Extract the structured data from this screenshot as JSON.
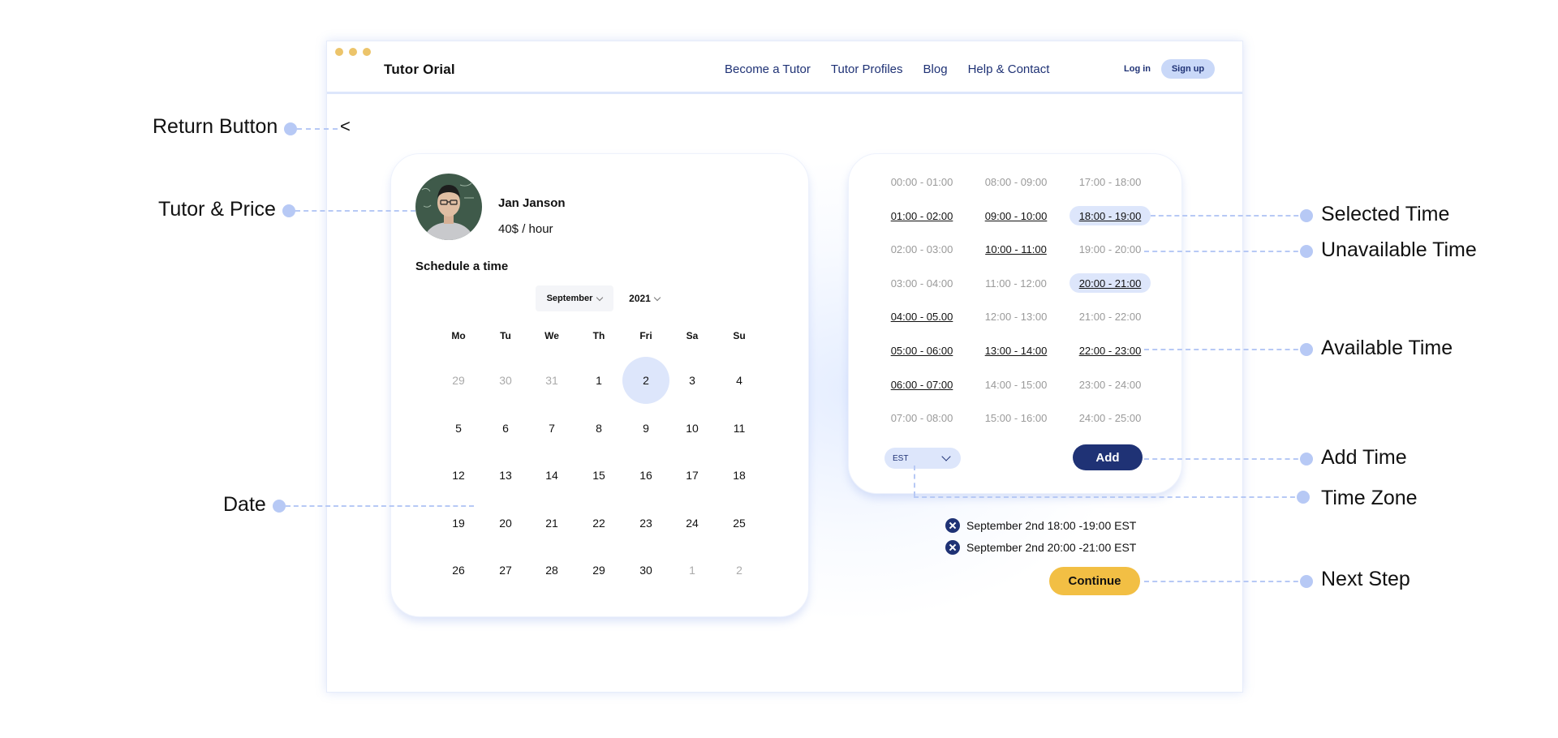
{
  "app": {
    "brand": "Tutor Orial"
  },
  "nav": [
    "Become a Tutor",
    "Tutor Profiles",
    "Blog",
    "Help & Contact"
  ],
  "auth": {
    "login": "Log in",
    "signup": "Sign up"
  },
  "back_glyph": "<",
  "tutor": {
    "name": "Jan Janson",
    "price": "40$ / hour"
  },
  "schedule": {
    "heading": "Schedule a time",
    "month": "September",
    "year": "2021",
    "weekdays": [
      "Mo",
      "Tu",
      "We",
      "Th",
      "Fri",
      "Sa",
      "Su"
    ],
    "selected_day": "2",
    "days": [
      {
        "d": "29",
        "muted": true
      },
      {
        "d": "30",
        "muted": true
      },
      {
        "d": "31",
        "muted": true
      },
      {
        "d": "1"
      },
      {
        "d": "2",
        "selected": true
      },
      {
        "d": "3"
      },
      {
        "d": "4"
      },
      {
        "d": "5"
      },
      {
        "d": "6"
      },
      {
        "d": "7"
      },
      {
        "d": "8"
      },
      {
        "d": "9"
      },
      {
        "d": "10"
      },
      {
        "d": "11"
      },
      {
        "d": "12"
      },
      {
        "d": "13"
      },
      {
        "d": "14"
      },
      {
        "d": "15"
      },
      {
        "d": "16"
      },
      {
        "d": "17"
      },
      {
        "d": "18"
      },
      {
        "d": "19"
      },
      {
        "d": "20"
      },
      {
        "d": "21"
      },
      {
        "d": "22"
      },
      {
        "d": "23"
      },
      {
        "d": "24"
      },
      {
        "d": "25"
      },
      {
        "d": "26"
      },
      {
        "d": "27"
      },
      {
        "d": "28"
      },
      {
        "d": "29"
      },
      {
        "d": "30"
      },
      {
        "d": "1",
        "muted": true
      },
      {
        "d": "2",
        "muted": true
      }
    ]
  },
  "times": {
    "columns": [
      [
        {
          "t": "00:00 - 01:00",
          "s": "unavailable"
        },
        {
          "t": "01:00 - 02:00",
          "s": "available"
        },
        {
          "t": "02:00 - 03:00",
          "s": "unavailable"
        },
        {
          "t": "03:00 - 04:00",
          "s": "unavailable"
        },
        {
          "t": "04:00 - 05.00",
          "s": "available"
        },
        {
          "t": "05:00 - 06:00",
          "s": "available"
        },
        {
          "t": "06:00 - 07:00",
          "s": "available"
        },
        {
          "t": "07:00 - 08:00",
          "s": "unavailable"
        }
      ],
      [
        {
          "t": "08:00 - 09:00",
          "s": "unavailable"
        },
        {
          "t": "09:00 - 10:00",
          "s": "available"
        },
        {
          "t": "10:00 - 11:00",
          "s": "available"
        },
        {
          "t": "11:00 - 12:00",
          "s": "unavailable"
        },
        {
          "t": "12:00 - 13:00",
          "s": "unavailable"
        },
        {
          "t": "13:00 - 14:00",
          "s": "available"
        },
        {
          "t": "14:00 - 15:00",
          "s": "unavailable"
        },
        {
          "t": "15:00 - 16:00",
          "s": "unavailable"
        }
      ],
      [
        {
          "t": "17:00 - 18:00",
          "s": "unavailable"
        },
        {
          "t": "18:00 - 19:00",
          "s": "selected"
        },
        {
          "t": "19:00 - 20:00",
          "s": "unavailable"
        },
        {
          "t": "20:00 - 21:00",
          "s": "selected"
        },
        {
          "t": "21:00 - 22:00",
          "s": "unavailable"
        },
        {
          "t": "22:00 - 23:00",
          "s": "available"
        },
        {
          "t": "23:00 - 24:00",
          "s": "unavailable"
        },
        {
          "t": "24:00 - 25:00",
          "s": "unavailable"
        }
      ]
    ],
    "timezone": "EST",
    "add_label": "Add"
  },
  "chosen_slots": [
    "September 2nd 18:00 -19:00 EST",
    "September 2nd 20:00 -21:00 EST"
  ],
  "continue_label": "Continue",
  "annotations": {
    "return_button": "Return Button",
    "tutor_price": "Tutor & Price",
    "date": "Date",
    "selected_time": "Selected Time",
    "unavailable_time": "Unavailable Time",
    "available_time": "Available Time",
    "add_time": "Add Time",
    "time_zone": "Time Zone",
    "next_step": "Next Step"
  },
  "colors": {
    "accent": "#1f3275",
    "highlight": "#dde6fb",
    "cta": "#f2bf44",
    "window_dots": "#ecc46a",
    "annotation": "#b7c9f5"
  },
  "icons": {
    "back": "chevron-left-icon",
    "remove": "close-circle-icon",
    "dropdown": "chevron-down-icon"
  }
}
